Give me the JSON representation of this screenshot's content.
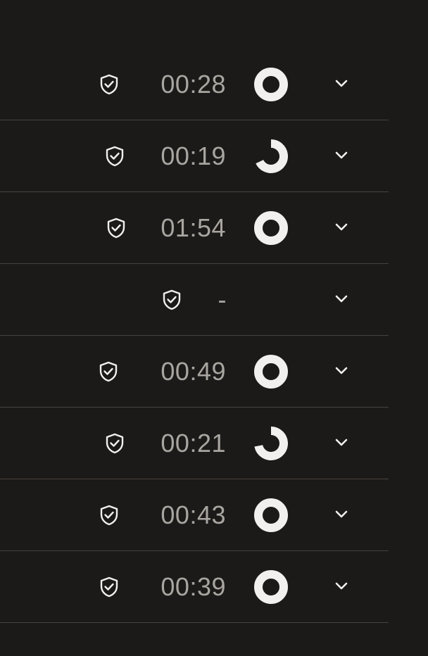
{
  "rows": [
    {
      "time": "00:28",
      "progress": 1.0,
      "icon": "shield-check-icon"
    },
    {
      "time": "00:19",
      "progress": 0.68,
      "icon": "shield-check-icon"
    },
    {
      "time": "01:54",
      "progress": 1.0,
      "icon": "shield-check-icon"
    },
    {
      "time": "-",
      "progress": null,
      "icon": "shield-check-icon"
    },
    {
      "time": "00:49",
      "progress": 1.0,
      "icon": "shield-check-icon"
    },
    {
      "time": "00:21",
      "progress": 0.72,
      "icon": "shield-check-icon"
    },
    {
      "time": "00:43",
      "progress": 1.0,
      "icon": "shield-check-icon"
    },
    {
      "time": "00:39",
      "progress": 1.0,
      "icon": "shield-check-icon"
    }
  ],
  "colors": {
    "background": "#1c1a19",
    "divider": "#46423f",
    "text": "#a9a5a0",
    "icon": "#f2f0ee"
  }
}
